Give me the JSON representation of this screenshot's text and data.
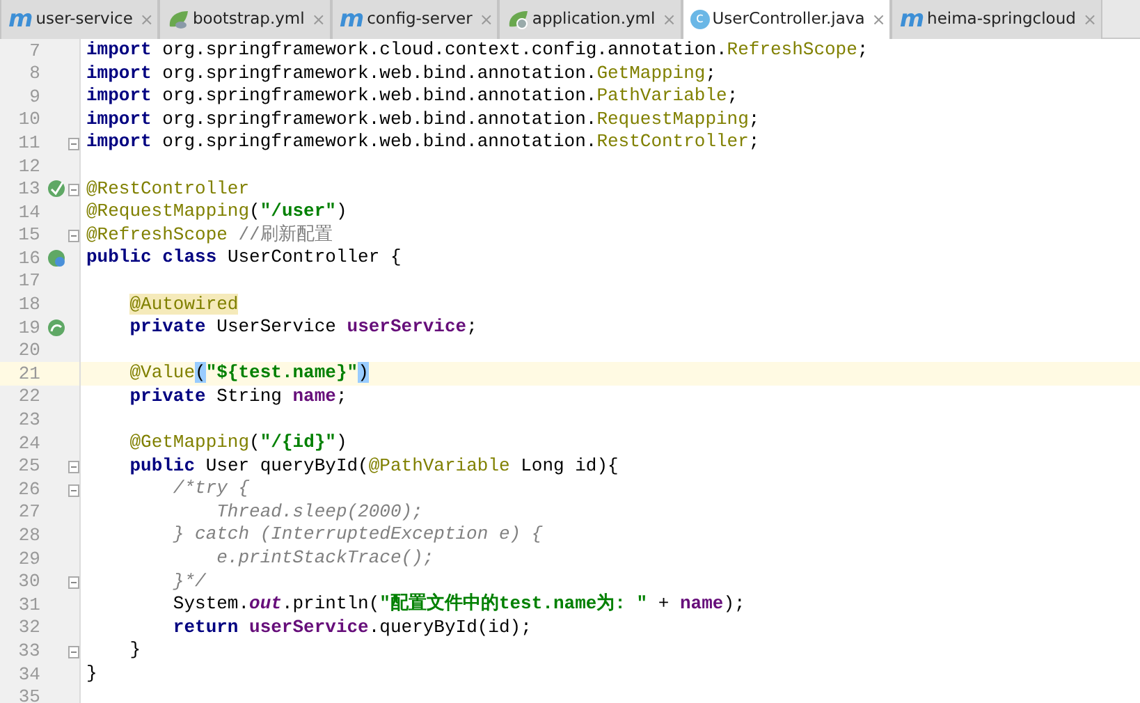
{
  "tabs": [
    {
      "label": "user-service",
      "kind": "module",
      "icon_text": "m",
      "selected": false,
      "close": "×"
    },
    {
      "label": "bootstrap.yml",
      "kind": "yml",
      "selected": false,
      "close": "×"
    },
    {
      "label": "config-server",
      "kind": "module",
      "icon_text": "m",
      "selected": false,
      "close": "×"
    },
    {
      "label": "application.yml",
      "kind": "ymlgear",
      "selected": false,
      "close": "×"
    },
    {
      "label": "UserController.java",
      "kind": "class",
      "icon_text": "c",
      "selected": true,
      "close": "×"
    },
    {
      "label": "heima-springcloud",
      "kind": "module",
      "icon_text": "m",
      "selected": false,
      "close": "×"
    }
  ],
  "editor": {
    "lines": [
      {
        "number": "7",
        "current": false,
        "tokens": [
          {
            "kind": "kw",
            "t": "import"
          },
          {
            "kind": "plain",
            "t": " org.springframework.cloud.context.config.annotation."
          },
          {
            "kind": "ann",
            "t": "RefreshScope"
          },
          {
            "kind": "plain",
            "t": ";"
          }
        ]
      },
      {
        "number": "8",
        "current": false,
        "tokens": [
          {
            "kind": "kw",
            "t": "import"
          },
          {
            "kind": "plain",
            "t": " org.springframework.web.bind.annotation."
          },
          {
            "kind": "ann",
            "t": "GetMapping"
          },
          {
            "kind": "plain",
            "t": ";"
          }
        ]
      },
      {
        "number": "9",
        "current": false,
        "tokens": [
          {
            "kind": "kw",
            "t": "import"
          },
          {
            "kind": "plain",
            "t": " org.springframework.web.bind.annotation."
          },
          {
            "kind": "ann",
            "t": "PathVariable"
          },
          {
            "kind": "plain",
            "t": ";"
          }
        ]
      },
      {
        "number": "10",
        "current": false,
        "tokens": [
          {
            "kind": "kw",
            "t": "import"
          },
          {
            "kind": "plain",
            "t": " org.springframework.web.bind.annotation."
          },
          {
            "kind": "ann",
            "t": "RequestMapping"
          },
          {
            "kind": "plain",
            "t": ";"
          }
        ]
      },
      {
        "number": "11",
        "current": false,
        "fold": true,
        "tokens": [
          {
            "kind": "kw",
            "t": "import"
          },
          {
            "kind": "plain",
            "t": " org.springframework.web.bind.annotation."
          },
          {
            "kind": "ann",
            "t": "RestController"
          },
          {
            "kind": "plain",
            "t": ";"
          }
        ]
      },
      {
        "number": "12",
        "current": false
      },
      {
        "number": "13",
        "current": false,
        "fold": true,
        "gutter": {
          "kind": "bean"
        },
        "tokens": [
          {
            "kind": "ann",
            "t": "@RestController"
          }
        ]
      },
      {
        "number": "14",
        "current": false,
        "tokens": [
          {
            "kind": "ann",
            "t": "@RequestMapping"
          },
          {
            "kind": "plain",
            "t": "("
          },
          {
            "kind": "str",
            "t": "\"/user\""
          },
          {
            "kind": "plain",
            "t": ")"
          }
        ]
      },
      {
        "number": "15",
        "current": false,
        "fold": true,
        "tokens": [
          {
            "kind": "ann",
            "t": "@RefreshScope"
          },
          {
            "kind": "linecomment",
            "t": " //刷新配置"
          }
        ]
      },
      {
        "number": "16",
        "current": false,
        "gutter": {
          "kind": "beanweb"
        },
        "tokens": [
          {
            "kind": "kw",
            "t": "public class"
          },
          {
            "kind": "plain",
            "t": " UserController {"
          }
        ]
      },
      {
        "number": "17",
        "current": false
      },
      {
        "number": "18",
        "current": false,
        "tokens": [
          {
            "kind": "annhl",
            "t": "    @Autowired"
          }
        ]
      },
      {
        "number": "19",
        "current": false,
        "gutter": {
          "kind": "beanlink"
        },
        "tokens": [
          {
            "kind": "kw",
            "t": "    private"
          },
          {
            "kind": "plain",
            "t": " UserService "
          },
          {
            "kind": "field",
            "t": "userService"
          },
          {
            "kind": "plain",
            "t": ";"
          }
        ]
      },
      {
        "number": "20",
        "current": false
      },
      {
        "number": "21",
        "current": true,
        "tokens": [
          {
            "kind": "ann",
            "t": "    @Value"
          },
          {
            "kind": "match",
            "t": "("
          },
          {
            "kind": "str",
            "t": "\"${test.name}\""
          },
          {
            "kind": "match",
            "t": ")"
          }
        ]
      },
      {
        "number": "22",
        "current": false,
        "tokens": [
          {
            "kind": "kw",
            "t": "    private"
          },
          {
            "kind": "plain",
            "t": " String "
          },
          {
            "kind": "field",
            "t": "name"
          },
          {
            "kind": "plain",
            "t": ";"
          }
        ]
      },
      {
        "number": "23",
        "current": false
      },
      {
        "number": "24",
        "current": false,
        "tokens": [
          {
            "kind": "ann",
            "t": "    @GetMapping"
          },
          {
            "kind": "plain",
            "t": "("
          },
          {
            "kind": "str",
            "t": "\"/{id}\""
          },
          {
            "kind": "plain",
            "t": ")"
          }
        ]
      },
      {
        "number": "25",
        "current": false,
        "fold": true,
        "tokens": [
          {
            "kind": "kw",
            "t": "    public"
          },
          {
            "kind": "plain",
            "t": " User queryById("
          },
          {
            "kind": "ann",
            "t": "@PathVariable"
          },
          {
            "kind": "plain",
            "t": " Long id){"
          }
        ]
      },
      {
        "number": "26",
        "current": false,
        "fold": true,
        "tokens": [
          {
            "kind": "comment",
            "t": "        /*try {"
          }
        ]
      },
      {
        "number": "27",
        "current": false,
        "tokens": [
          {
            "kind": "comment",
            "t": "            Thread.sleep(2000);"
          }
        ]
      },
      {
        "number": "28",
        "current": false,
        "tokens": [
          {
            "kind": "comment",
            "t": "        } catch (InterruptedException e) {"
          }
        ]
      },
      {
        "number": "29",
        "current": false,
        "tokens": [
          {
            "kind": "comment",
            "t": "            e.printStackTrace();"
          }
        ]
      },
      {
        "number": "30",
        "current": false,
        "fold": true,
        "tokens": [
          {
            "kind": "comment",
            "t": "        }*/"
          }
        ]
      },
      {
        "number": "31",
        "current": false,
        "tokens": [
          {
            "kind": "plain",
            "t": "        System."
          },
          {
            "kind": "static",
            "t": "out"
          },
          {
            "kind": "plain",
            "t": ".println("
          },
          {
            "kind": "str",
            "t": "\"配置文件中的test.name为: \""
          },
          {
            "kind": "plain",
            "t": " + "
          },
          {
            "kind": "field",
            "t": "name"
          },
          {
            "kind": "plain",
            "t": ");"
          }
        ]
      },
      {
        "number": "32",
        "current": false,
        "tokens": [
          {
            "kind": "kw",
            "t": "        return "
          },
          {
            "kind": "field",
            "t": "userService"
          },
          {
            "kind": "plain",
            "t": ".queryById(id);"
          }
        ]
      },
      {
        "number": "33",
        "current": false,
        "fold": true,
        "tokens": [
          {
            "kind": "plain",
            "t": "    }"
          }
        ]
      },
      {
        "number": "34",
        "current": false,
        "tokens": [
          {
            "kind": "plain",
            "t": "}"
          }
        ]
      },
      {
        "number": "35",
        "current": false
      }
    ]
  }
}
